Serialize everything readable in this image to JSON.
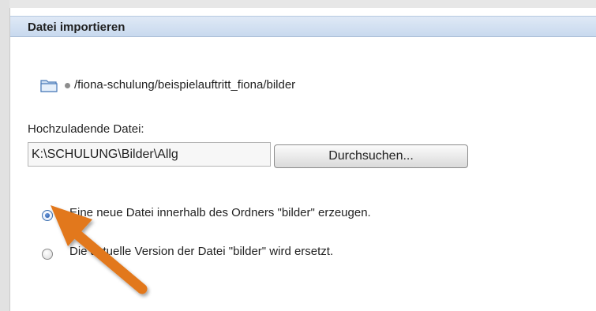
{
  "dialog": {
    "title": "Datei importieren",
    "folder_icon": "folder-icon",
    "path": "/fiona-schulung/beispielauftritt_fiona/bilder"
  },
  "upload": {
    "label": "Hochzuladende Datei:",
    "value": "K:\\SCHULUNG\\Bilder\\Allg",
    "browse_label": "Durchsuchen..."
  },
  "options": [
    {
      "label": "Eine neue Datei innerhalb des Ordners \"bilder\" erzeugen.",
      "selected": true
    },
    {
      "label": "Die aktuelle Version der Datei \"bilder\" wird ersetzt.",
      "selected": false
    }
  ],
  "annotation": {
    "icon": "arrow-pointer",
    "color": "#e2781b"
  },
  "colors": {
    "header_bg": "#d4e2f3",
    "accent": "#3b6fb0"
  }
}
